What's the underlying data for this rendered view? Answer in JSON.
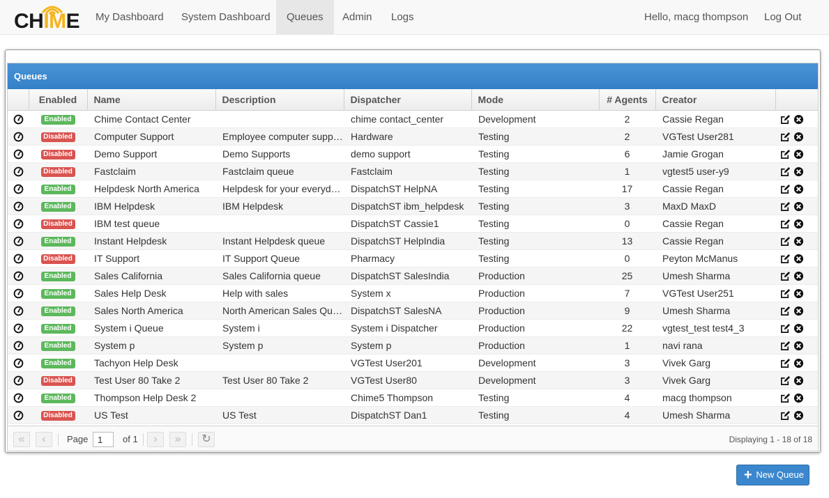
{
  "brand": {
    "text_a": "CH",
    "text_b": "IM",
    "text_c": "E"
  },
  "nav": {
    "items": [
      "My Dashboard",
      "System Dashboard",
      "Queues",
      "Admin",
      "Logs"
    ],
    "active": "Queues",
    "greeting": "Hello, macg thompson",
    "logout": "Log Out"
  },
  "panel": {
    "title": "Queues"
  },
  "grid": {
    "columns": [
      "",
      "Enabled",
      "Name",
      "Description",
      "Dispatcher",
      "Mode",
      "# Agents",
      "Creator",
      ""
    ],
    "rows": [
      {
        "status": "Enabled",
        "name": "Chime Contact Center",
        "description": "",
        "dispatcher": "chime contact_center",
        "mode": "Development",
        "agents": "2",
        "creator": "Cassie Regan"
      },
      {
        "status": "Disabled",
        "name": "Computer Support",
        "description": "Employee computer support",
        "dispatcher": "Hardware",
        "mode": "Testing",
        "agents": "2",
        "creator": "VGTest User281"
      },
      {
        "status": "Disabled",
        "name": "Demo Support",
        "description": "Demo Supports",
        "dispatcher": "demo support",
        "mode": "Testing",
        "agents": "6",
        "creator": "Jamie Grogan"
      },
      {
        "status": "Disabled",
        "name": "Fastclaim",
        "description": "Fastclaim queue",
        "dispatcher": "Fastclaim",
        "mode": "Testing",
        "agents": "1",
        "creator": "vgtest5 user-y9"
      },
      {
        "status": "Enabled",
        "name": "Helpdesk North America",
        "description": "Helpdesk for your everyday needs",
        "dispatcher": "DispatchST HelpNA",
        "mode": "Testing",
        "agents": "17",
        "creator": "Cassie Regan"
      },
      {
        "status": "Enabled",
        "name": "IBM Helpdesk",
        "description": "IBM Helpdesk",
        "dispatcher": "DispatchST ibm_helpdesk",
        "mode": "Testing",
        "agents": "3",
        "creator": "MaxD MaxD"
      },
      {
        "status": "Disabled",
        "name": "IBM test queue",
        "description": "",
        "dispatcher": "DispatchST Cassie1",
        "mode": "Testing",
        "agents": "0",
        "creator": "Cassie Regan"
      },
      {
        "status": "Enabled",
        "name": "Instant Helpdesk",
        "description": "Instant Helpdesk queue",
        "dispatcher": "DispatchST HelpIndia",
        "mode": "Testing",
        "agents": "13",
        "creator": "Cassie Regan"
      },
      {
        "status": "Disabled",
        "name": "IT Support",
        "description": "IT Support Queue",
        "dispatcher": "Pharmacy",
        "mode": "Testing",
        "agents": "0",
        "creator": "Peyton McManus"
      },
      {
        "status": "Enabled",
        "name": "Sales California",
        "description": "Sales California queue",
        "dispatcher": "DispatchST SalesIndia",
        "mode": "Production",
        "agents": "25",
        "creator": "Umesh Sharma"
      },
      {
        "status": "Enabled",
        "name": "Sales Help Desk",
        "description": "Help with sales",
        "dispatcher": "System x",
        "mode": "Production",
        "agents": "7",
        "creator": "VGTest User251"
      },
      {
        "status": "Enabled",
        "name": "Sales North America",
        "description": "North American Sales Queue",
        "dispatcher": "DispatchST SalesNA",
        "mode": "Production",
        "agents": "9",
        "creator": "Umesh Sharma"
      },
      {
        "status": "Enabled",
        "name": "System i Queue",
        "description": "System i",
        "dispatcher": "System i Dispatcher",
        "mode": "Production",
        "agents": "22",
        "creator": "vgtest_test test4_3"
      },
      {
        "status": "Enabled",
        "name": "System p",
        "description": "System p",
        "dispatcher": "System p",
        "mode": "Production",
        "agents": "1",
        "creator": "navi rana"
      },
      {
        "status": "Enabled",
        "name": "Tachyon Help Desk",
        "description": "",
        "dispatcher": "VGTest User201",
        "mode": "Development",
        "agents": "3",
        "creator": "Vivek Garg"
      },
      {
        "status": "Disabled",
        "name": "Test User 80 Take 2",
        "description": "Test User 80 Take 2",
        "dispatcher": "VGTest User80",
        "mode": "Development",
        "agents": "3",
        "creator": "Vivek Garg"
      },
      {
        "status": "Enabled",
        "name": "Thompson Help Desk 2",
        "description": "",
        "dispatcher": "Chime5 Thompson",
        "mode": "Testing",
        "agents": "4",
        "creator": "macg thompson"
      },
      {
        "status": "Disabled",
        "name": "US Test",
        "description": "US Test",
        "dispatcher": "DispatchST Dan1",
        "mode": "Testing",
        "agents": "4",
        "creator": "Umesh Sharma"
      }
    ]
  },
  "paging": {
    "page_label": "Page",
    "page_value": "1",
    "of_label": "of 1",
    "display": "Displaying 1 - 18 of 18"
  },
  "new_button": {
    "label": "New Queue"
  },
  "colors": {
    "accent": "#3a87ce",
    "enabled": "#5cb85c",
    "disabled": "#d9534f",
    "brand_yellow": "#f6b51c"
  }
}
